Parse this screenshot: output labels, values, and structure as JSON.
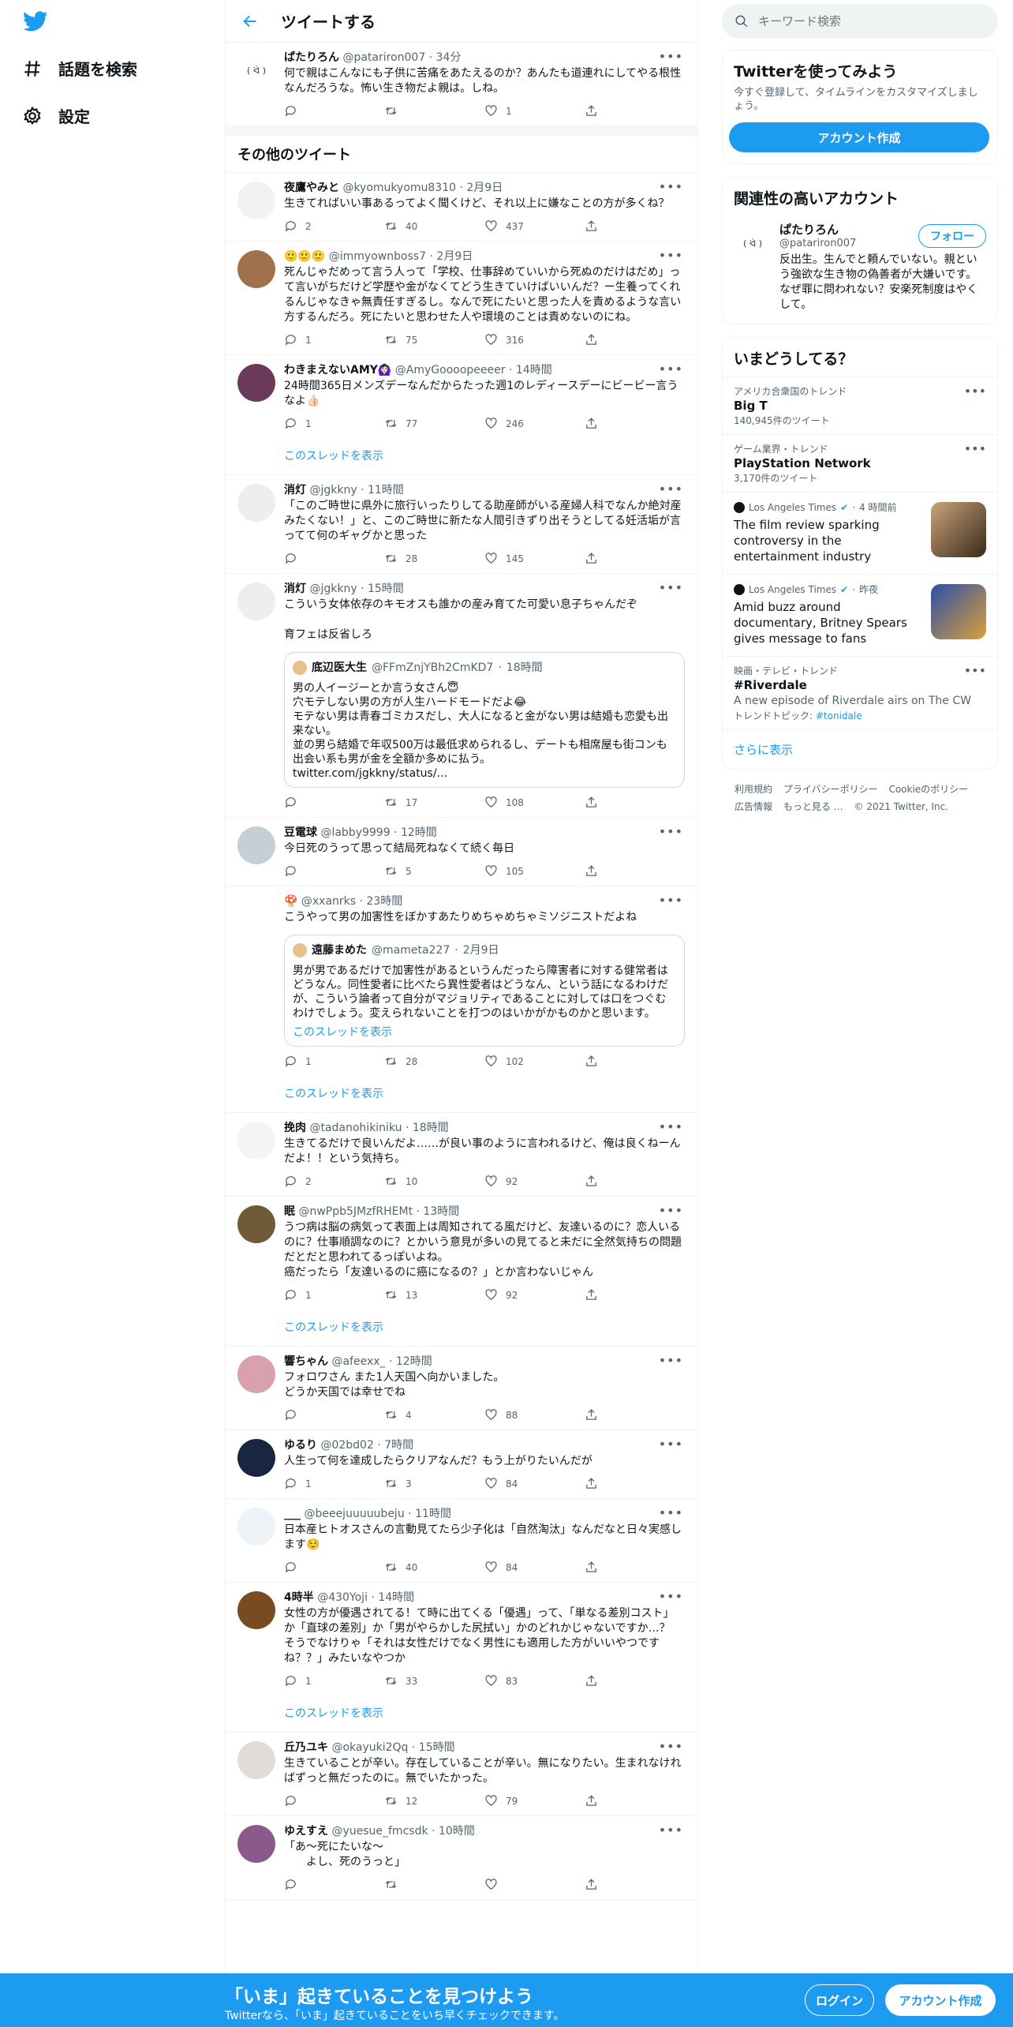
{
  "nav": {
    "explore": "話題を検索",
    "settings": "設定"
  },
  "header": {
    "title": "ツイートする"
  },
  "main_tweet": {
    "name": "ぱたりろん",
    "handle": "@patariron007",
    "time": "34分",
    "text": "何で親はこんなにも子供に苦痛をあたえるのか？あんたも道連れにしてやる根性なんだろうな。怖い生き物だよ親は。しね。",
    "replies": "",
    "retweets": "",
    "likes": "1",
    "avatar": "( ᐛ )"
  },
  "section_title": "その他のツイート",
  "tweets": [
    {
      "name": "夜鷹やみと",
      "handle": "@kyomukyomu8310",
      "time": "2月9日",
      "text": "生きてればいい事あるってよく聞くけど、それ以上に嫌なことの方が多くね？",
      "replies": "2",
      "retweets": "40",
      "likes": "437",
      "thread": "",
      "avatar_color": "#f2f2f2"
    },
    {
      "name": "🙂🙂🙂",
      "handle": "@immyownboss7",
      "time": "2月9日",
      "text": "死んじゃだめって言う人って「学校、仕事辞めていいから死ぬのだけはだめ」って言いがちだけど学歴や金がなくてどう生きていけばいいんだ？ー生養ってくれるんじゃなきゃ無責任すぎるし。なんで死にたいと思った人を責めるような言い方するんだろ。死にたいと思わせた人や環境のことは責めないのにね。",
      "replies": "1",
      "retweets": "75",
      "likes": "316",
      "thread": "",
      "avatar_color": "#a0714b"
    },
    {
      "name": "わきまえないAMY🙆🏻‍♀️",
      "handle": "@AmyGoooopeeeer",
      "time": "14時間",
      "text": "24時間365日メンズデーなんだからたった週1のレディースデーにビービー言うなよ👍🏻",
      "replies": "1",
      "retweets": "77",
      "likes": "246",
      "thread": "このスレッドを表示",
      "avatar_color": "#6b3a5a"
    },
    {
      "name": "消灯",
      "handle": "@jgkkny",
      "time": "11時間",
      "text": "「このご時世に県外に旅行いったりしてる助産師がいる産婦人科でなんか絶対産みたくない！」と、このご時世に新たな人間引きずり出そうとしてる妊活垢が言ってて何のギャグかと思った",
      "replies": "",
      "retweets": "28",
      "likes": "145",
      "thread": "",
      "avatar_color": "#eeeeee"
    },
    {
      "name": "消灯",
      "handle": "@jgkkny",
      "time": "15時間",
      "text": "こういう女体依存のキモオスも誰かの産み育てた可愛い息子ちゃんだぞ\n\n育フェは反省しろ",
      "replies": "",
      "retweets": "17",
      "likes": "108",
      "thread": "",
      "avatar_color": "#eeeeee",
      "quote": {
        "name": "底辺医大生",
        "handle": "@FFmZnjYBh2CmKD7",
        "time": "18時間",
        "text": "男の人イージーとか言う女さん😇\n穴モテしない男の方が人生ハードモードだよ😂\nモテない男は青春ゴミカスだし、大人になると金がない男は結婚も恋愛も出来ない。\n並の男ら結婚で年収500万は最低求められるし、デートも相席屋も街コンも出会い系も男が金を全額か多めに払う。\ntwitter.com/jgkkny/status/..."
      }
    },
    {
      "name": "豆電球",
      "handle": "@labby9999",
      "time": "12時間",
      "text": "今日死のうって思って結局死ねなくて続く毎日",
      "replies": "",
      "retweets": "5",
      "likes": "105",
      "thread": "",
      "avatar_color": "#c4cfd6"
    },
    {
      "name": "🍄",
      "handle": "@xxanrks",
      "time": "23時間",
      "text": "こうやって男の加害性をぼかすあたりめちゃめちゃミソジニストだよね",
      "replies": "1",
      "retweets": "28",
      "likes": "102",
      "thread": "このスレッドを表示",
      "avatar_color": "#ffffff",
      "quote": {
        "name": "遠藤まめた",
        "handle": "@mameta227",
        "time": "2月9日",
        "text": "男が男であるだけで加害性があるというんだったら障害者に対する健常者はどうなん。同性愛者に比べたら異性愛者はどうなん、という話になるわけだが、こういう論者って自分がマジョリティであることに対しては口をつぐむわけでしょう。変えられないことを打つのはいかがかものかと思います。",
        "link": "このスレッドを表示"
      }
    },
    {
      "name": "挽肉",
      "handle": "@tadanohikiniku",
      "time": "18時間",
      "text": "生きてるだけで良いんだよ……が良い事のように言われるけど、俺は良くねーんだよ！！という気持ち。",
      "replies": "2",
      "retweets": "10",
      "likes": "92",
      "thread": "",
      "avatar_color": "#f4f4f4"
    },
    {
      "name": "眠",
      "handle": "@nwPpb5JMzfRHEMt",
      "time": "13時間",
      "text": "うつ病は脳の病気って表面上は周知されてる風だけど、友達いるのに？恋人いるのに？仕事順調なのに？とかいう意見が多いの見てると未だに全然気持ちの問題だとだと思われてるっぽいよね。\n癌だったら「友達いるのに癌になるの？」とか言わないじゃん",
      "replies": "1",
      "retweets": "13",
      "likes": "92",
      "thread": "このスレッドを表示",
      "avatar_color": "#6f5a3a"
    },
    {
      "name": "響ちゃん",
      "handle": "@afeexx_",
      "time": "12時間",
      "text": "フォロワさん また1人天国へ向かいました。\nどうか天国では幸せでね",
      "replies": "",
      "retweets": "4",
      "likes": "88",
      "thread": "",
      "avatar_color": "#d9a0b0"
    },
    {
      "name": "ゆるり",
      "handle": "@02bd02",
      "time": "7時間",
      "text": "人生って何を達成したらクリアなんだ？もう上がりたいんだが",
      "replies": "1",
      "retweets": "3",
      "likes": "84",
      "thread": "",
      "avatar_color": "#1a2640"
    },
    {
      "name": "___",
      "handle": "@beeejuuuuubeju",
      "time": "11時間",
      "text": "日本産ヒトオスさんの言動見てたら少子化は「自然淘汰」なんだなと日々実感します☺️",
      "replies": "",
      "retweets": "40",
      "likes": "84",
      "thread": "",
      "avatar_color": "#eef3f8"
    },
    {
      "name": "4時半",
      "handle": "@430Yoji",
      "time": "14時間",
      "text": "女性の方が優遇されてる！て時に出てくる「優遇」って、「単なる差別コスト」か「直球の差別」か「男がやらかした尻拭い」かのどれかじゃないですか…？\nそうでなけりゃ「それは女性だけでなく男性にも適用した方がいいやつですね？？」みたいなやつか",
      "replies": "1",
      "retweets": "33",
      "likes": "83",
      "thread": "このスレッドを表示",
      "avatar_color": "#7a4a20"
    },
    {
      "name": "丘乃ユキ",
      "handle": "@okayuki2Qq",
      "time": "15時間",
      "text": "生きていることが辛い。存在していることが辛い。無になりたい。生まれなければずっと無だったのに。無でいたかった。",
      "replies": "",
      "retweets": "12",
      "likes": "79",
      "thread": "",
      "avatar_color": "#e0dcd8"
    },
    {
      "name": "ゆえすえ",
      "handle": "@yuesue_fmcsdk",
      "time": "10時間",
      "text": "「あ〜死にたいな〜\n　　よし、死のうっと」",
      "replies": "",
      "retweets": "",
      "likes": "",
      "thread": "",
      "avatar_color": "#8a5a8a"
    }
  ],
  "right": {
    "search_placeholder": "キーワード検索",
    "signup_box": {
      "title": "Twitterを使ってみよう",
      "sub": "今すぐ登録して、タイムラインをカスタマイズしましょう。",
      "button": "アカウント作成"
    },
    "related": {
      "title": "関連性の高いアカウント",
      "name": "ぱたりろん",
      "handle": "@patariron007",
      "bio": "反出生。生んでと頼んでいない。親という強欲な生き物の偽善者が大嫌いです。なぜ罪に問われない？安楽死制度はやくして。",
      "follow": "フォロー",
      "avatar": "( ᐛ )"
    },
    "trends_title": "いまどうしてる？",
    "trends": [
      {
        "context": "アメリカ合衆国のトレンド",
        "name": "Big T",
        "count": "140,945件のツイート"
      },
      {
        "context": "ゲーム業界・トレンド",
        "name": "PlayStation Network",
        "count": "3,170件のツイート"
      }
    ],
    "news": [
      {
        "source": "Los Angeles Times",
        "time": "4 時間前",
        "title": "The film review sparking controversy in the entertainment industry",
        "img1": "#c9a37a",
        "img2": "#3a2a1a"
      },
      {
        "source": "Los Angeles Times",
        "time": "昨夜",
        "title": "Amid buzz around documentary, Britney Spears gives message to fans",
        "img1": "#2b4fa8",
        "img2": "#d9a03a"
      }
    ],
    "tv_trend": {
      "context": "映画・テレビ・トレンド",
      "name": "#Riverdale",
      "desc": "A new episode of Riverdale airs on The CW",
      "topic_label": "トレンドトピック: ",
      "topic": "#tonidale"
    },
    "show_more": "さらに表示",
    "footer": [
      "利用規約",
      "プライバシーポリシー",
      "Cookieのポリシー",
      "広告情報",
      "もっと見る …",
      "© 2021 Twitter, Inc."
    ]
  },
  "bottom_bar": {
    "title": "「いま」起きていることを見つけよう",
    "sub": "Twitterなら、「いま」起きていることをいち早くチェックできます。",
    "login": "ログイン",
    "signup": "アカウント作成"
  },
  "colors": {
    "accent": "#1d9bf0",
    "text": "#0f1419",
    "muted": "#536471",
    "border": "#eff3f4"
  }
}
